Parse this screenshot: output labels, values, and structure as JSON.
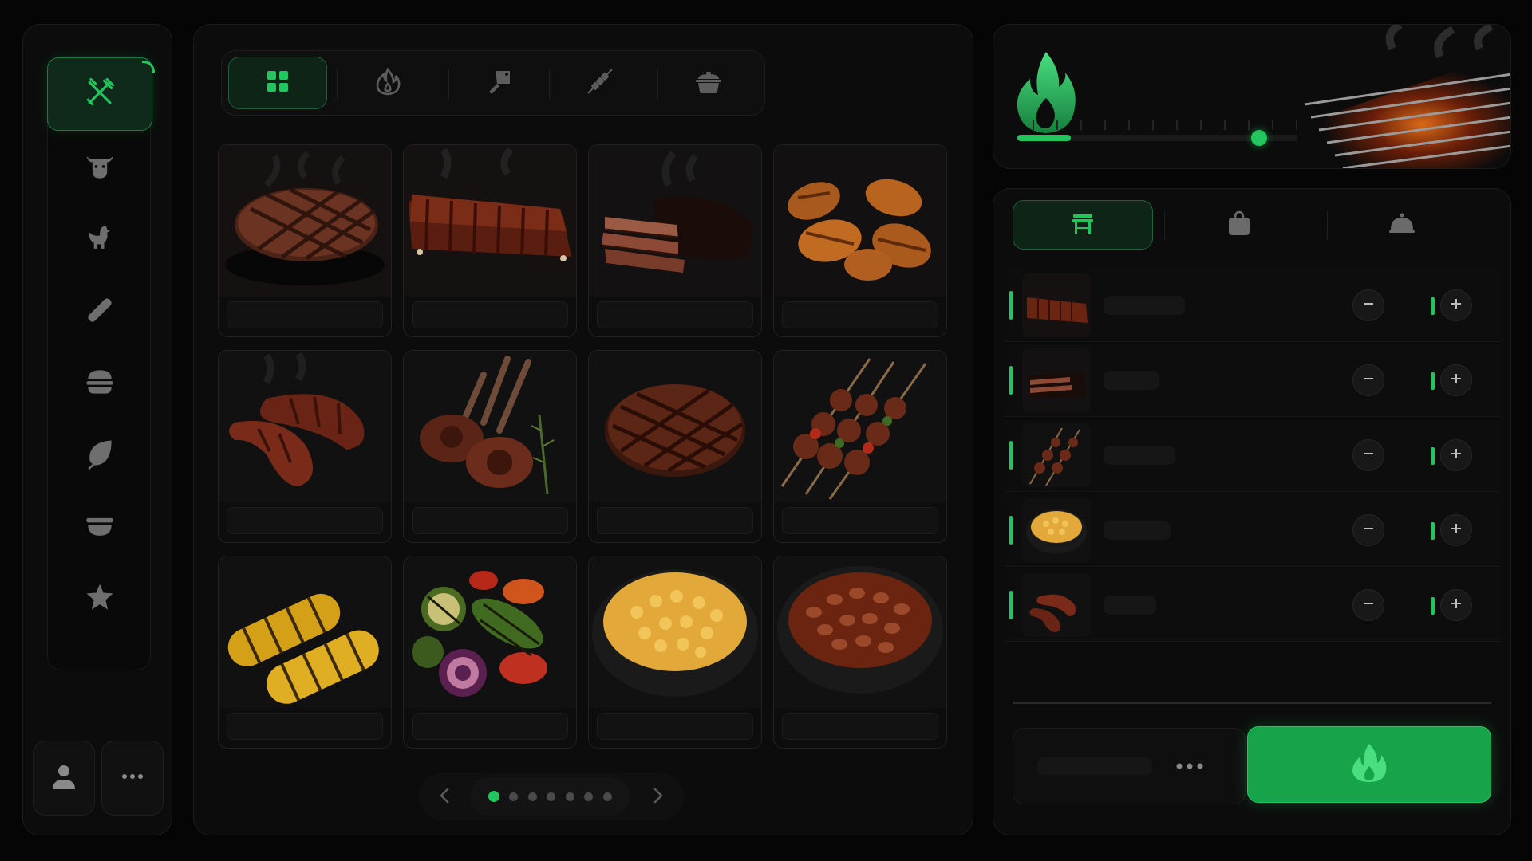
{
  "colors": {
    "accent": "#22c55e",
    "accent_dark": "#16a34a",
    "background": "#050505",
    "panel": "#0c0c0c"
  },
  "sidebar": {
    "categories": [
      {
        "icon": "grill-tools-icon",
        "active": true
      },
      {
        "icon": "beef-icon",
        "active": false
      },
      {
        "icon": "chicken-icon",
        "active": false
      },
      {
        "icon": "sausage-icon",
        "active": false
      },
      {
        "icon": "burger-icon",
        "active": false
      },
      {
        "icon": "leaf-icon",
        "active": false
      },
      {
        "icon": "bowl-icon",
        "active": false
      },
      {
        "icon": "star-icon",
        "active": false
      }
    ],
    "bottom_buttons": [
      {
        "icon": "user-icon"
      },
      {
        "icon": "more-icon"
      }
    ]
  },
  "menu": {
    "tabs": [
      {
        "icon": "grid-icon",
        "active": true
      },
      {
        "icon": "flame-icon",
        "active": false
      },
      {
        "icon": "cleaver-icon",
        "active": false
      },
      {
        "icon": "skewer-icon",
        "active": false
      },
      {
        "icon": "pot-icon",
        "active": false
      }
    ],
    "items": [
      {
        "icon": "steak-image"
      },
      {
        "icon": "ribs-image"
      },
      {
        "icon": "brisket-image"
      },
      {
        "icon": "wings-image"
      },
      {
        "icon": "sausages-image"
      },
      {
        "icon": "lamb-chops-image"
      },
      {
        "icon": "burger-patty-image"
      },
      {
        "icon": "kebab-skewers-image"
      },
      {
        "icon": "grilled-corn-image"
      },
      {
        "icon": "grilled-vegetables-image"
      },
      {
        "icon": "mac-and-cheese-image"
      },
      {
        "icon": "baked-beans-image"
      }
    ],
    "pagination": {
      "pages": 7,
      "current": 1
    }
  },
  "heat": {
    "level": 0.82,
    "fill": 0.18,
    "icon": "flame-icon"
  },
  "order": {
    "tabs": [
      {
        "icon": "dine-in-icon",
        "active": true
      },
      {
        "icon": "takeaway-bag-icon",
        "active": false
      },
      {
        "icon": "serving-cloche-icon",
        "active": false
      }
    ],
    "items": [
      {
        "icon": "ribs-image"
      },
      {
        "icon": "brisket-image"
      },
      {
        "icon": "kebab-skewers-image"
      },
      {
        "icon": "mac-and-cheese-image"
      },
      {
        "icon": "sausages-image"
      }
    ],
    "fire_button_icon": "flame-icon"
  }
}
